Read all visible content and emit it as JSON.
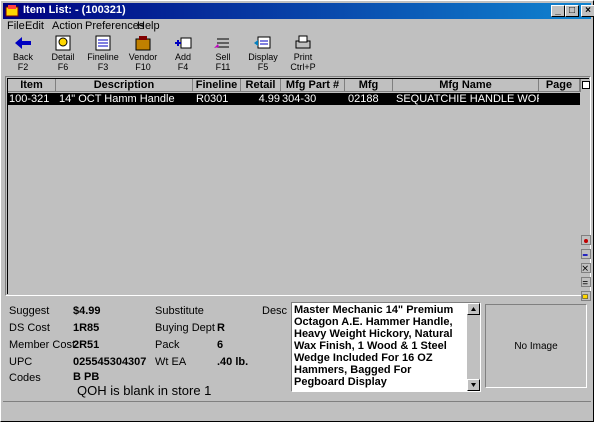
{
  "window": {
    "title": "Item List: - (100321)",
    "controls": {
      "minimize": "_",
      "maximize": "□",
      "close": "×"
    }
  },
  "menu": [
    "File",
    "Edit",
    "Action",
    "Preferences",
    "Help"
  ],
  "toolbar": [
    {
      "label": "Back",
      "key": "F2",
      "icon": "back-arrow-icon"
    },
    {
      "label": "Detail",
      "key": "F6",
      "icon": "detail-icon"
    },
    {
      "label": "Fineline",
      "key": "F3",
      "icon": "fineline-icon"
    },
    {
      "label": "Vendor",
      "key": "F10",
      "icon": "vendor-icon"
    },
    {
      "label": "Add",
      "key": "F4",
      "icon": "add-icon"
    },
    {
      "label": "Sell",
      "key": "F11",
      "icon": "sell-icon"
    },
    {
      "label": "Display",
      "key": "F5",
      "icon": "display-icon"
    },
    {
      "label": "Print",
      "key": "Ctrl+P",
      "icon": "print-icon"
    }
  ],
  "grid": {
    "columns": [
      "Item",
      "Description",
      "Fineline",
      "Retail",
      "Mfg Part #",
      "Mfg",
      "Mfg Name",
      "Page"
    ],
    "rows": [
      {
        "item": "100-321",
        "description": "14\" OCT Hamm Handle",
        "fineline": "R0301",
        "retail": "4.99",
        "mfg_part": "304-30",
        "mfg": "02188",
        "mfg_name": "SEQUATCHIE HANDLE WORKS, INC.",
        "page": ""
      }
    ]
  },
  "details": {
    "suggest_label": "Suggest",
    "suggest_value": "$4.99",
    "ds_cost_label": "DS Cost",
    "ds_cost_value": "1R85",
    "member_cost_label": "Member Cost",
    "member_cost_value": "2R51",
    "upc_label": "UPC",
    "upc_value": "025545304307",
    "codes_label": "Codes",
    "codes_value": "B PB",
    "substitute_label": "Substitute",
    "substitute_value": "",
    "buying_dept_label": "Buying Dept",
    "buying_dept_value": "R",
    "pack_label": "Pack",
    "pack_value": "6",
    "wt_label": "Wt EA",
    "wt_value": ".40 lb.",
    "desc_label": "Desc",
    "desc_value": "Master Mechanic 14\" Premium Octagon A.E. Hammer Handle, Heavy Weight Hickory, Natural Wax Finish, 1 Wood & 1 Steel Wedge Included For 16 OZ Hammers, Bagged For Pegboard Display",
    "qoh_message": "QOH is blank in store 1",
    "no_image": "No Image"
  },
  "colors": {
    "title_bar": "#000080",
    "selected_row": "#000000",
    "window_bg": "#c0c0c0"
  }
}
